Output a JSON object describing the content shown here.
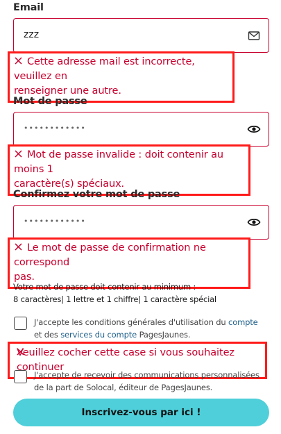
{
  "email": {
    "label": "Email",
    "value": "zzz",
    "icon": "envelope-icon",
    "error_line1": "Cette adresse mail est incorrecte, veuillez en",
    "error_line2": "renseigner une autre."
  },
  "password": {
    "label": "Mot de passe",
    "value": "••••••••••••",
    "icon": "eye-icon",
    "error_line1": "Mot de passe invalide : doit contenir au moins 1",
    "error_line2": "caractère(s) spéciaux."
  },
  "confirm": {
    "label": "Confirmez votre mot de passe",
    "value": "••••••••••••",
    "icon": "eye-icon",
    "error_line1": "Le mot de passe de confirmation ne correspond",
    "error_line2": "pas."
  },
  "requirements": {
    "line1": "Votre mot de passe doit contenir au minimum :",
    "line2": "8 caractères| 1 lettre et 1 chiffre| 1 caractère spécial"
  },
  "terms": {
    "text_a": "J'accepte les conditions générales d'utilisation du ",
    "link1": "compte",
    "text_b": "et des ",
    "link2": "services du compte",
    "text_c": " PagesJaunes.",
    "error": "Veuillez cocher cette case si vous souhaitez continuer"
  },
  "newsletter": {
    "line1": "J'accepte de recevoir des communications personnalisées",
    "line2": "de la part de Solocal, éditeur de PagesJaunes."
  },
  "submit_label": "Inscrivez-vous par ici !",
  "colors": {
    "error": "#c8002e",
    "highlight_box": "#ff1a1a",
    "cta": "#4ecfd9",
    "link": "#1c5e8a"
  }
}
